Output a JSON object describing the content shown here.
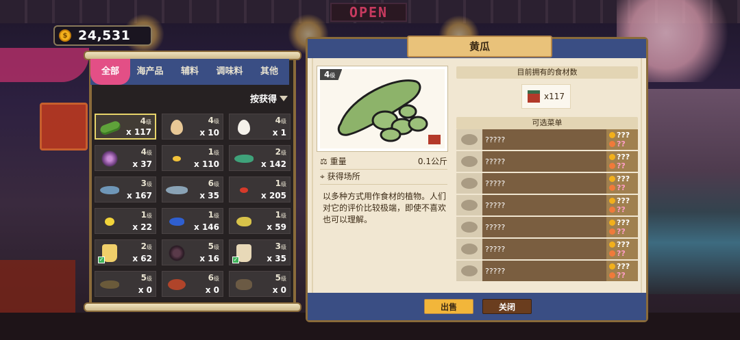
{
  "hud": {
    "coins": "24,531",
    "coin_symbol": "$"
  },
  "background": {
    "open_sign": "OPEN"
  },
  "inventory": {
    "tabs": [
      "全部",
      "海产品",
      "辅料",
      "调味料",
      "其他"
    ],
    "active_tab": 0,
    "sort_label": "按获得",
    "grade_suffix": "级",
    "items": [
      {
        "icon": "cucumber-icon",
        "level": "4",
        "qty": "x 117",
        "selected": true
      },
      {
        "icon": "egg-icon",
        "level": "4",
        "qty": "x 10"
      },
      {
        "icon": "white-egg-icon",
        "level": "4",
        "qty": "x 1"
      },
      {
        "icon": "sea-urchin-icon",
        "level": "4",
        "qty": "x 37"
      },
      {
        "icon": "small-fish-icon",
        "level": "1",
        "qty": "x 110"
      },
      {
        "icon": "green-fish-icon",
        "level": "2",
        "qty": "x 142"
      },
      {
        "icon": "blue-fish-icon",
        "level": "3",
        "qty": "x 167"
      },
      {
        "icon": "shark-icon",
        "level": "6",
        "qty": "x 35"
      },
      {
        "icon": "red-fish-icon",
        "level": "1",
        "qty": "x 205"
      },
      {
        "icon": "yellow-fish-icon",
        "level": "1",
        "qty": "x 22"
      },
      {
        "icon": "tang-fish-icon",
        "level": "1",
        "qty": "x 146"
      },
      {
        "icon": "puffer-fish-icon",
        "level": "1",
        "qty": "x 59"
      },
      {
        "icon": "seasoning-icon",
        "level": "2",
        "qty": "x 62",
        "checked": true
      },
      {
        "icon": "urchin-dark-icon",
        "level": "5",
        "qty": "x 16"
      },
      {
        "icon": "sack-icon",
        "level": "3",
        "qty": "x 35",
        "checked": true
      },
      {
        "icon": "catfish-icon",
        "level": "5",
        "qty": "x 0"
      },
      {
        "icon": "crab-icon",
        "level": "6",
        "qty": "x 0"
      },
      {
        "icon": "pot-icon",
        "level": "5",
        "qty": "x 0"
      }
    ]
  },
  "detail": {
    "title": "黄瓜",
    "grade": "4",
    "weight_label": "重量",
    "weight_value": "0.1公斤",
    "location_label": "获得场所",
    "description": "以多种方式用作食材的植物。人们对它的评价比较极端，即使不喜欢也可以理解。",
    "owned_header": "目前拥有的食材数",
    "owned_count": "x117",
    "menu_header": "可选菜单",
    "menus": [
      {
        "name": "?????",
        "price": "???",
        "rating": "??"
      },
      {
        "name": "?????",
        "price": "???",
        "rating": "??"
      },
      {
        "name": "?????",
        "price": "???",
        "rating": "??"
      },
      {
        "name": "?????",
        "price": "???",
        "rating": "??"
      },
      {
        "name": "?????",
        "price": "???",
        "rating": "??"
      },
      {
        "name": "?????",
        "price": "???",
        "rating": "??"
      },
      {
        "name": "?????",
        "price": "???",
        "rating": "??"
      }
    ],
    "sell_label": "出售",
    "close_label": "关闭"
  },
  "colors": {
    "tab_bar": "#3a4e84",
    "tab_active": "#e34f86",
    "panel_bg": "#f1e7d2",
    "sell_button": "#f2b63a",
    "close_button": "#6a3d1e"
  }
}
